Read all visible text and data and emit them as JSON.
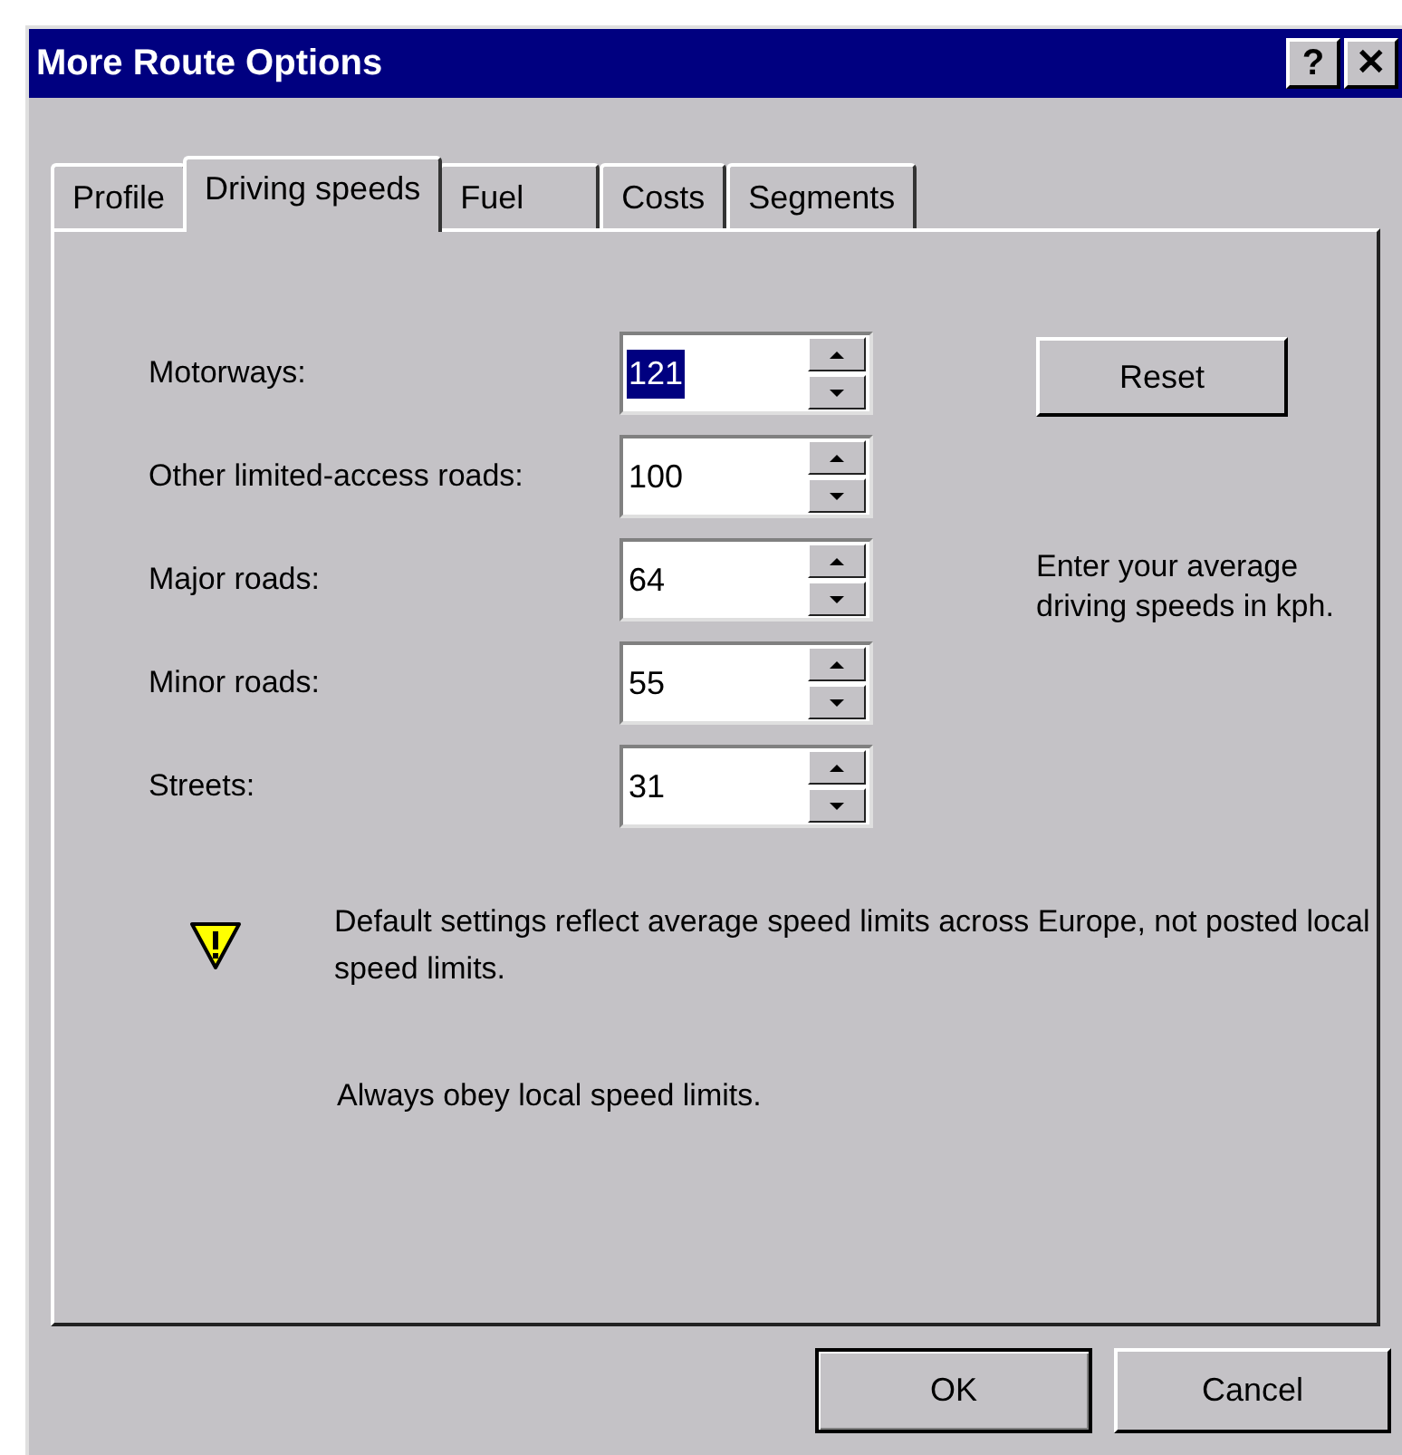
{
  "window": {
    "title": "More Route Options",
    "title_buttons": [
      "?",
      "✕"
    ]
  },
  "tabs": [
    {
      "label": "Profile",
      "selected": false
    },
    {
      "label": "Driving speeds",
      "selected": true
    },
    {
      "label": "Fuel",
      "selected": false
    },
    {
      "label": "Costs",
      "selected": false
    },
    {
      "label": "Segments",
      "selected": false
    }
  ],
  "speeds": [
    {
      "label": "Motorways:",
      "value": "121",
      "selected": true
    },
    {
      "label": "Other limited-access roads:",
      "value": "100",
      "selected": false
    },
    {
      "label": "Major roads:",
      "value": "64",
      "selected": false
    },
    {
      "label": "Minor roads:",
      "value": "55",
      "selected": false
    },
    {
      "label": "Streets:",
      "value": "31",
      "selected": false
    }
  ],
  "reset_button": "Reset",
  "hint": "Enter your average driving speeds in kph.",
  "warning": "Default settings reflect average speed limits across Europe, not posted local speed limits.",
  "notice": "Always obey local speed limits.",
  "buttons": [
    {
      "label": "OK",
      "default": true
    },
    {
      "label": "Cancel",
      "default": false
    }
  ]
}
